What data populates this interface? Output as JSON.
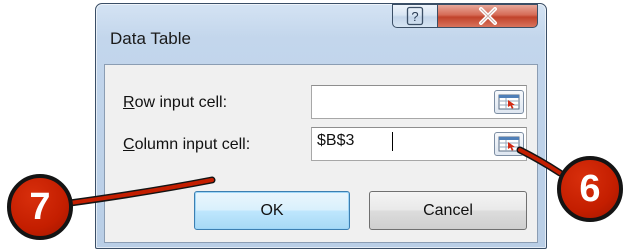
{
  "dialog": {
    "title": "Data Table",
    "help_symbol": "?",
    "close_symbol": "X"
  },
  "fields": {
    "row_input": {
      "label": "Row input cell:",
      "underline": "R",
      "rest": "ow input cell:",
      "value": ""
    },
    "column_input": {
      "label": "Column input cell:",
      "underline": "C",
      "rest": "olumn input cell:",
      "value": "$B$3"
    }
  },
  "buttons": {
    "ok_label": "OK",
    "cancel_label": "Cancel"
  },
  "callouts": {
    "left_badge": "7",
    "right_badge": "6"
  },
  "colors": {
    "callout_red": "#c41e00",
    "close_red": "#c1432b",
    "frame_blue": "#c3d6ec"
  },
  "icons": {
    "collapse_dialog": "range-selector-icon",
    "help": "help-icon",
    "close": "close-icon"
  }
}
